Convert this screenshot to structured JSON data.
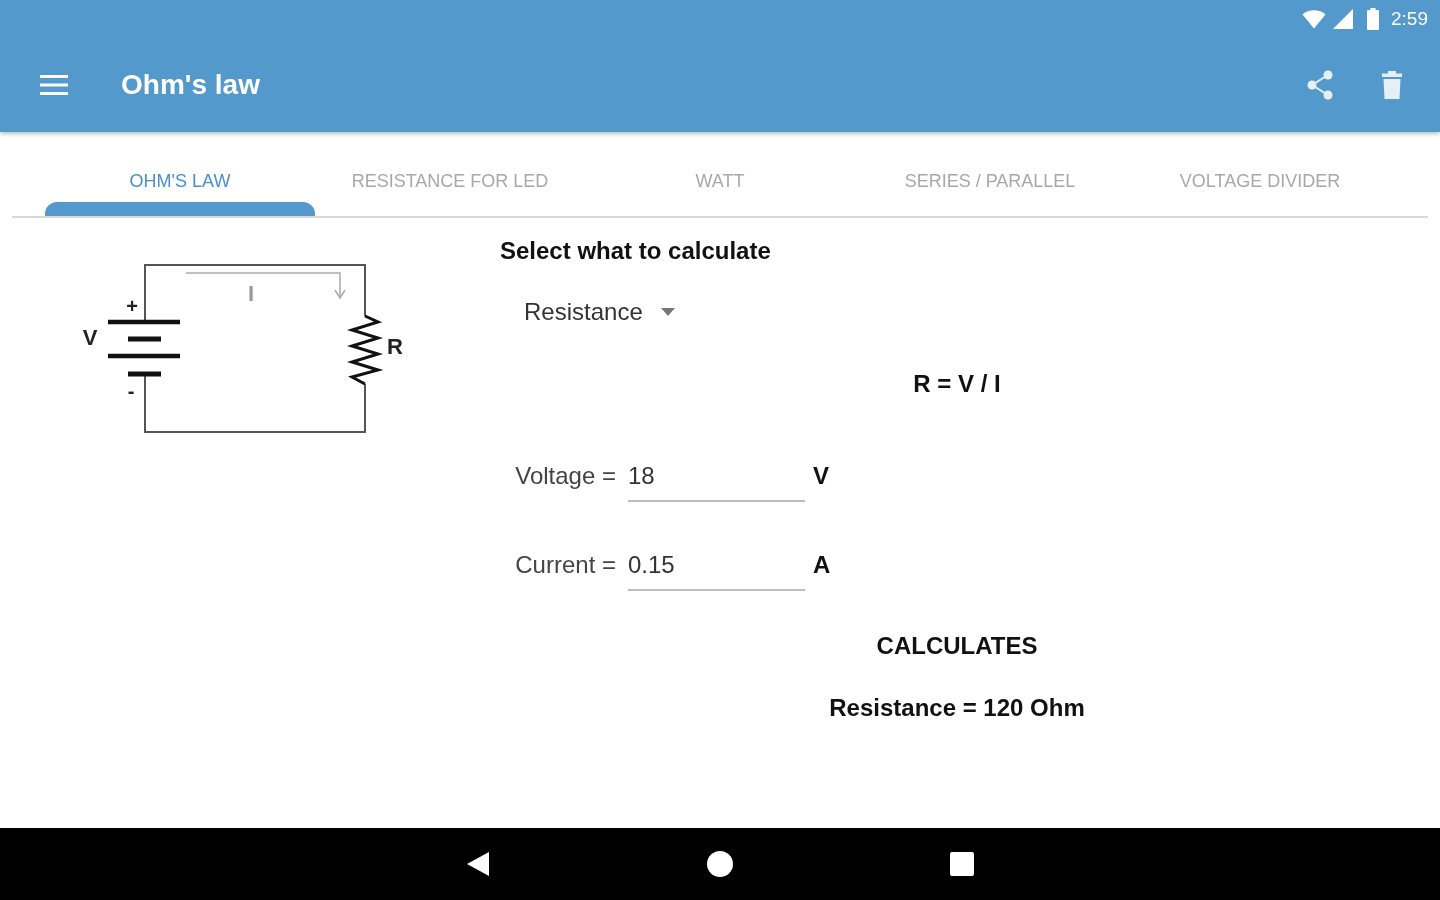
{
  "status_bar": {
    "time": "2:59"
  },
  "app_bar": {
    "title": "Ohm's law"
  },
  "tabs": [
    {
      "label": "OHM'S LAW",
      "selected": true
    },
    {
      "label": "RESISTANCE FOR LED",
      "selected": false
    },
    {
      "label": "WATT",
      "selected": false
    },
    {
      "label": "SERIES / PARALLEL",
      "selected": false
    },
    {
      "label": "VOLTAGE DIVIDER",
      "selected": false
    }
  ],
  "circuit_diagram": {
    "source_label": "V",
    "positive_sign": "+",
    "negative_sign": "-",
    "current_label": "I",
    "resistor_label": "R"
  },
  "calculator": {
    "heading": "Select what to calculate",
    "quantity": "Resistance",
    "formula": "R = V / I",
    "inputs": [
      {
        "label": "Voltage =",
        "value": "18",
        "unit": "V"
      },
      {
        "label": "Current =",
        "value": "0.15",
        "unit": "A"
      }
    ],
    "calculate_button": "CALCULATES",
    "result": "Resistance = 120 Ohm"
  }
}
